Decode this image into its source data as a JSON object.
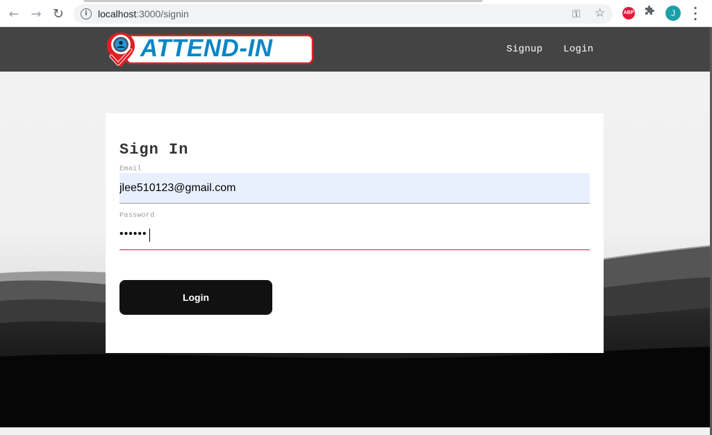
{
  "browser": {
    "url_host": "localhost",
    "url_rest": ":3000/signin",
    "back_icon": "arrow-left-icon",
    "forward_icon": "arrow-right-icon",
    "reload_icon": "reload-icon",
    "extension_abp_label": "ABP",
    "profile_initial": "J"
  },
  "header": {
    "logo_text": "ATTEND-IN",
    "nav": [
      {
        "label": "Signup"
      },
      {
        "label": "Login"
      }
    ]
  },
  "signin": {
    "title": "Sign In",
    "email_label": "Email",
    "email_value": "jlee510123@gmail.com",
    "password_label": "Password",
    "password_value": "••••••",
    "submit_label": "Login"
  },
  "colors": {
    "header_bg": "#444444",
    "logo_blue": "#0b86c6",
    "logo_red": "#e31e24",
    "input_underline_focus": "#c2185b",
    "button_bg": "#111111",
    "autofill_bg": "#e8f0fe"
  }
}
